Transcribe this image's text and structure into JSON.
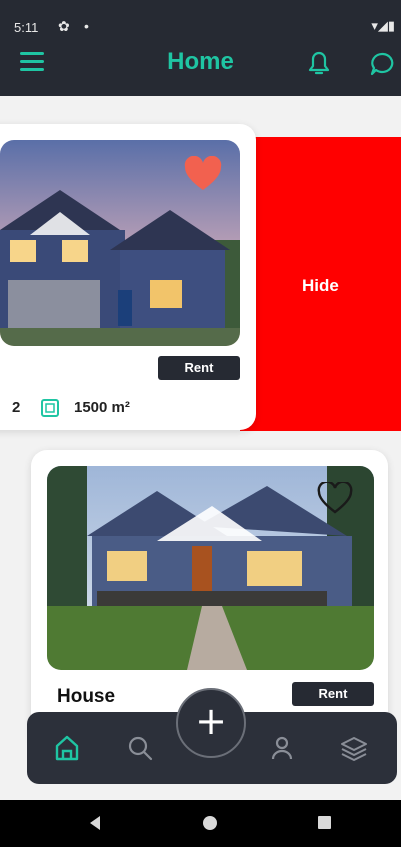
{
  "status_bar": {
    "time": "5:11",
    "gear_icon": "gear-icon",
    "dot": "•",
    "right_icons": "▾◢▮"
  },
  "header": {
    "title": "Home",
    "menu_icon": "hamburger-menu-icon",
    "bell_icon": "bell-icon",
    "chat_icon": "chat-bubble-icon"
  },
  "colors": {
    "accent": "#1fc5a3",
    "header_bg": "#262a33",
    "hide": "#ff0000",
    "favorite": "#f2614f"
  },
  "listings": [
    {
      "tag": "Rent",
      "favorited": true,
      "bedrooms": "2",
      "area": "1500 m²",
      "swipe_action": "Hide"
    },
    {
      "title": "House",
      "tag": "Rent",
      "favorited": false
    }
  ],
  "bottom_nav": {
    "items": [
      "home",
      "search",
      "profile",
      "layers"
    ],
    "active": "home",
    "fab": "+"
  }
}
